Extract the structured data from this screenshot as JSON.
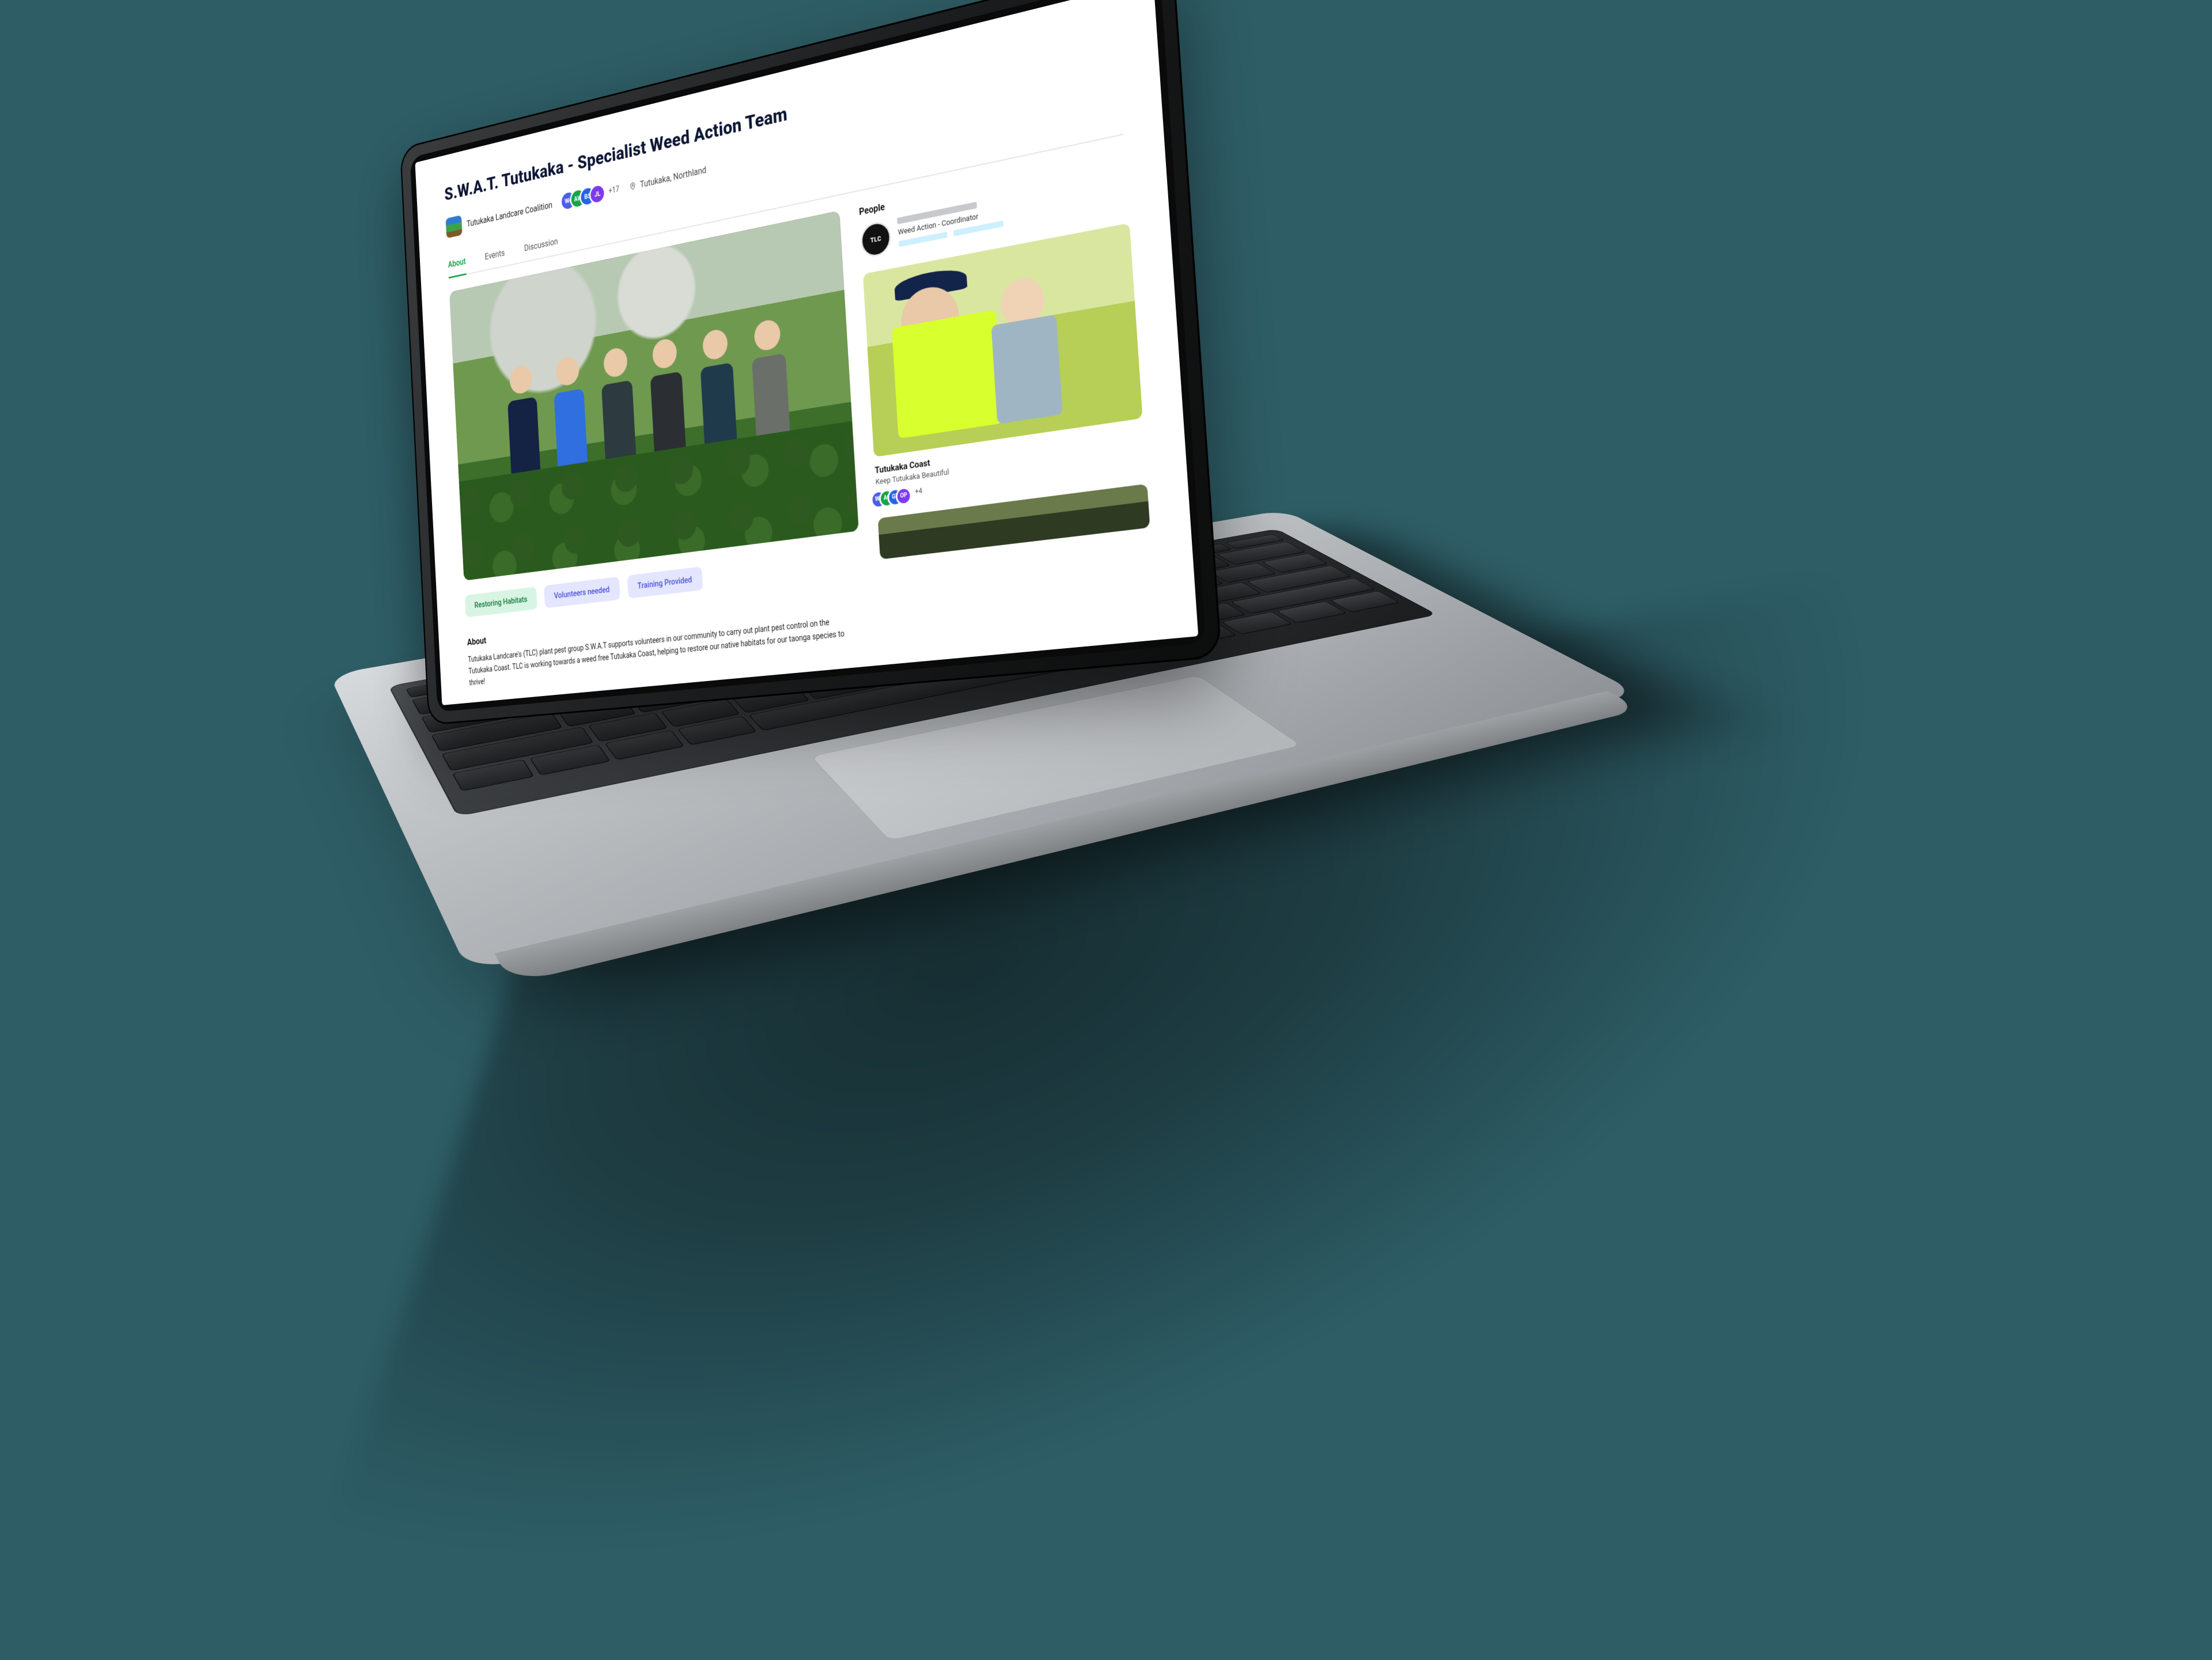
{
  "page": {
    "title": "S.W.A.T. Tutukaka - Specialist Weed Action Team",
    "org_name": "Tutukaka Landcare Coalition",
    "avatar_overflow": "+17",
    "location": "Tutukaka, Northland"
  },
  "tabs": {
    "about": "About",
    "events": "Events",
    "discussion": "Discussion"
  },
  "avatars": [
    "We",
    "AW",
    "BS",
    "JL"
  ],
  "tags": {
    "restoring": "Restoring Habitats",
    "volunteers": "Volunteers needed",
    "training": "Training Provided"
  },
  "about": {
    "heading": "About",
    "body": "Tutukaka Landcare's (TLC)  plant pest group S.W.A.T supports volunteers in our community to carry out plant pest control on the Tutukaka Coast.  TLC is working towards a weed free Tutukaka Coast, helping to restore our native habitats for our taonga species to thrive!"
  },
  "sidebar": {
    "people_heading": "People",
    "person_role": "Weed Action - Coordinator",
    "person_avatar_text": "TLC",
    "card_title": "Tutukaka Coast",
    "card_subtitle": "Keep Tutukaka Beautiful",
    "mini_avatars": [
      "We",
      "AC",
      "GR",
      "OP"
    ],
    "mini_overflow": "+4"
  }
}
